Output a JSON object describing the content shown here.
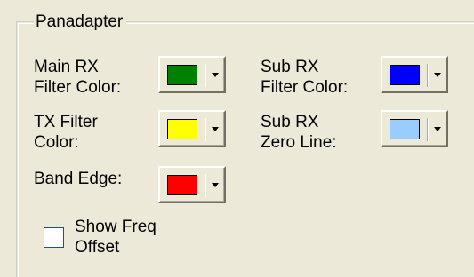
{
  "group": {
    "title": "Panadapter"
  },
  "fields": {
    "main_rx": {
      "label": "Main RX\nFilter Color:",
      "color": "#008000"
    },
    "sub_rx": {
      "label": "Sub RX\nFilter Color:",
      "color": "#0000ff"
    },
    "tx": {
      "label": "TX Filter\nColor:",
      "color": "#ffff00"
    },
    "sub_rx_zero": {
      "label": "Sub RX\nZero Line:",
      "color": "#99ccff"
    },
    "band_edge": {
      "label": "Band Edge:",
      "color": "#ff0000"
    }
  },
  "show_freq_offset": {
    "label": "Show Freq\nOffset",
    "checked": false
  }
}
